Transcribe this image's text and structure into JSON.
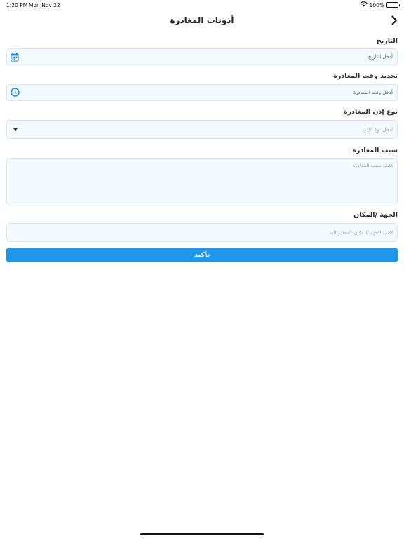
{
  "status_bar": {
    "time": "1:20 PM",
    "date": "Mon Nov 22",
    "battery": "100%",
    "battery_level": 1.0
  },
  "header": {
    "title": "أذونات المغادرة",
    "back_icon": "chevron-right-icon"
  },
  "form": {
    "date": {
      "label": "التاريخ",
      "placeholder": "أدخل التاريخ",
      "icon": "calendar-icon"
    },
    "time": {
      "label": "تحديد وقت المغادرة",
      "placeholder": "أدخل وقت المغادرة",
      "icon": "clock-icon"
    },
    "permit_type": {
      "label": "نوع إذن المغادرة",
      "placeholder": "ادخل نوع الإذن",
      "icon": "dropdown-arrow-icon"
    },
    "reason": {
      "label": "سبب المغادرة",
      "placeholder": "اكتب سبب المغادرة"
    },
    "destination": {
      "label": "الجهة /المكان",
      "placeholder": "اكتب الجهة /المكان المغادر اليه"
    },
    "submit_label": "تأكيد"
  },
  "colors": {
    "accent": "#2196e8",
    "field_bg": "#f4f9fd",
    "field_border": "#d8e8f2"
  }
}
